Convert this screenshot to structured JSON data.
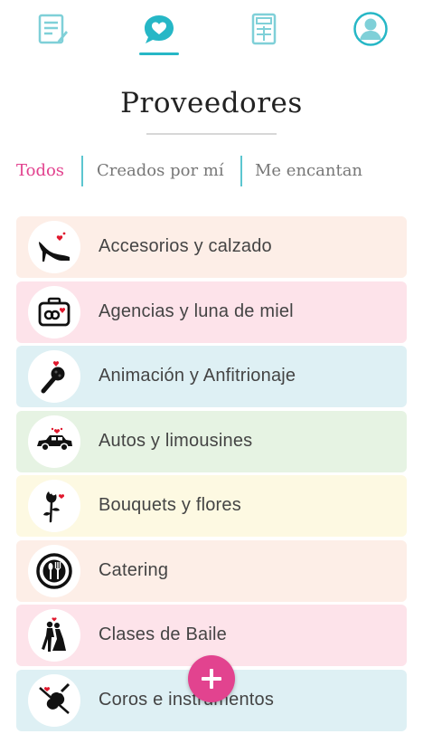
{
  "nav": {
    "tabs": [
      {
        "icon": "checklist-icon"
      },
      {
        "icon": "heart-chat-icon",
        "active": true
      },
      {
        "icon": "calculator-icon"
      },
      {
        "icon": "profile-icon"
      }
    ],
    "accent": "#26b7c6"
  },
  "page": {
    "title": "Proveedores"
  },
  "filters": {
    "all": "Todos",
    "mine": "Creados por mí",
    "liked": "Me encantan",
    "active_color": "#e2438f"
  },
  "categories": [
    {
      "label": "Accesorios y calzado",
      "icon": "high-heel-icon",
      "bg": "#fdeee7"
    },
    {
      "label": "Agencias y luna de miel",
      "icon": "suitcase-icon",
      "bg": "#fde3ea"
    },
    {
      "label": "Animación y Anfitrionaje",
      "icon": "microphone-icon",
      "bg": "#def0f4"
    },
    {
      "label": "Autos y limousines",
      "icon": "car-icon",
      "bg": "#e6f3e3"
    },
    {
      "label": "Bouquets y flores",
      "icon": "rose-icon",
      "bg": "#fdf9e2"
    },
    {
      "label": "Catering",
      "icon": "plate-cutlery-icon",
      "bg": "#fdeee7"
    },
    {
      "label": "Clases de Baile",
      "icon": "dancers-icon",
      "bg": "#fde3ea"
    },
    {
      "label": "Coros e instrumentos",
      "icon": "violin-icon",
      "bg": "#def0f4"
    }
  ],
  "fab": {
    "icon": "plus-icon",
    "color": "#e2438f"
  }
}
